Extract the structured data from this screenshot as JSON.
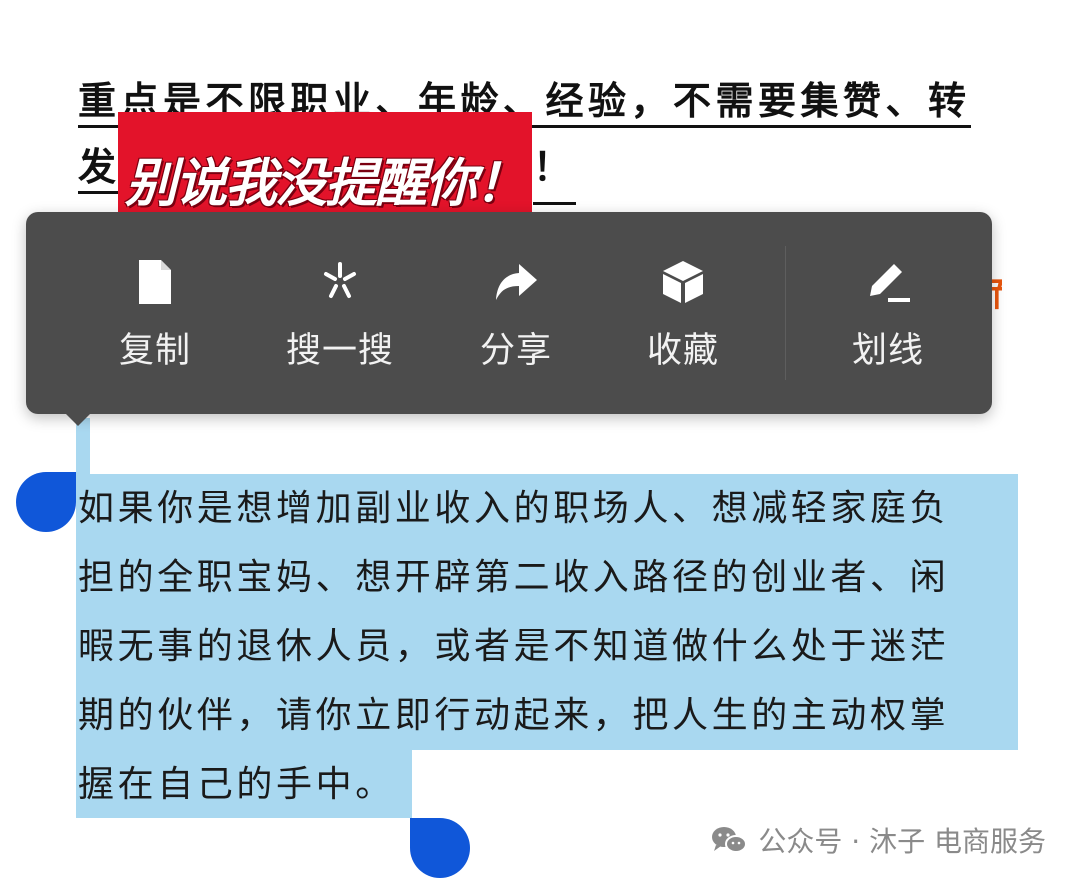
{
  "top_paragraph": {
    "line1": "重点是不限职业、年龄、经验，不需要集赞、转",
    "line2_start": "发",
    "line2_end": "！"
  },
  "sticker": {
    "text": "别说我没提醒你！",
    "color": "#e3132a"
  },
  "orange_fragment": "而",
  "context_menu": {
    "items": [
      {
        "label": "复制",
        "icon": "document-icon"
      },
      {
        "label": "搜一搜",
        "icon": "search-sparkle-icon"
      },
      {
        "label": "分享",
        "icon": "share-arrow-icon"
      },
      {
        "label": "收藏",
        "icon": "cube-icon"
      },
      {
        "label": "划线",
        "icon": "pen-underline-icon"
      }
    ]
  },
  "selected_paragraph": {
    "lines": [
      "如果你是想增加副业收入的职场人、想减轻家庭负",
      "担的全职宝妈、想开辟第二收入路径的创业者、闲",
      "暇无事的退休人员，或者是不知道做什么处于迷茫",
      "期的伙伴，请你立即行动起来，把人生的主动权掌",
      "握在自己的手中。"
    ],
    "highlight_color": "#a9d8f0",
    "handle_color": "#1057d9"
  },
  "watermark": {
    "text": "公众号 · 沐子 电商服务",
    "icon": "wechat-icon"
  }
}
